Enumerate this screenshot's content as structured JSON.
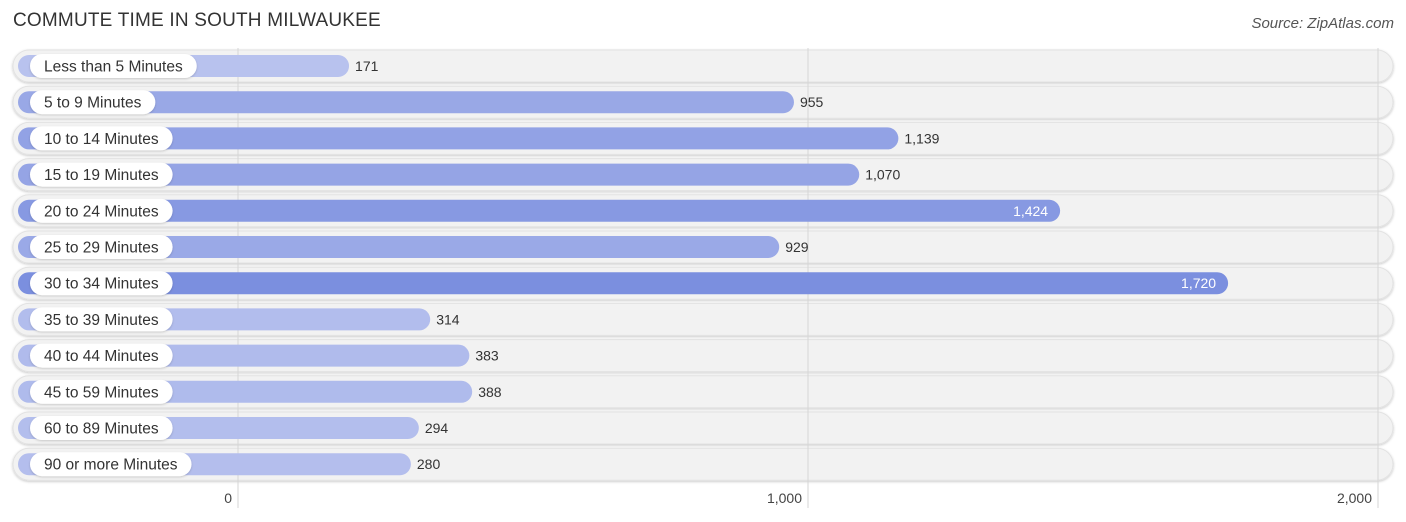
{
  "header": {
    "title": "COMMUTE TIME IN SOUTH MILWAUKEE",
    "source": "Source: ZipAtlas.com"
  },
  "chart_data": {
    "type": "bar",
    "orientation": "horizontal",
    "title": "COMMUTE TIME IN SOUTH MILWAUKEE",
    "xlabel": "",
    "ylabel": "",
    "categories": [
      "Less than 5 Minutes",
      "5 to 9 Minutes",
      "10 to 14 Minutes",
      "15 to 19 Minutes",
      "20 to 24 Minutes",
      "25 to 29 Minutes",
      "30 to 34 Minutes",
      "35 to 39 Minutes",
      "40 to 44 Minutes",
      "45 to 59 Minutes",
      "60 to 89 Minutes",
      "90 or more Minutes"
    ],
    "values": [
      171,
      955,
      1139,
      1070,
      1424,
      929,
      1720,
      314,
      383,
      388,
      294,
      280
    ],
    "value_labels": [
      "171",
      "955",
      "1,139",
      "1,070",
      "1,424",
      "929",
      "1,720",
      "314",
      "383",
      "388",
      "294",
      "280"
    ],
    "xlim": [
      0,
      2000
    ],
    "x_ticks": [
      0,
      1000,
      2000
    ],
    "x_tick_labels": [
      "0",
      "1,000",
      "2,000"
    ],
    "grid": true,
    "colors": {
      "bar_low": "#b8c2ee",
      "bar_high": "#7b8fdf",
      "track": "#f2f2f2"
    }
  }
}
